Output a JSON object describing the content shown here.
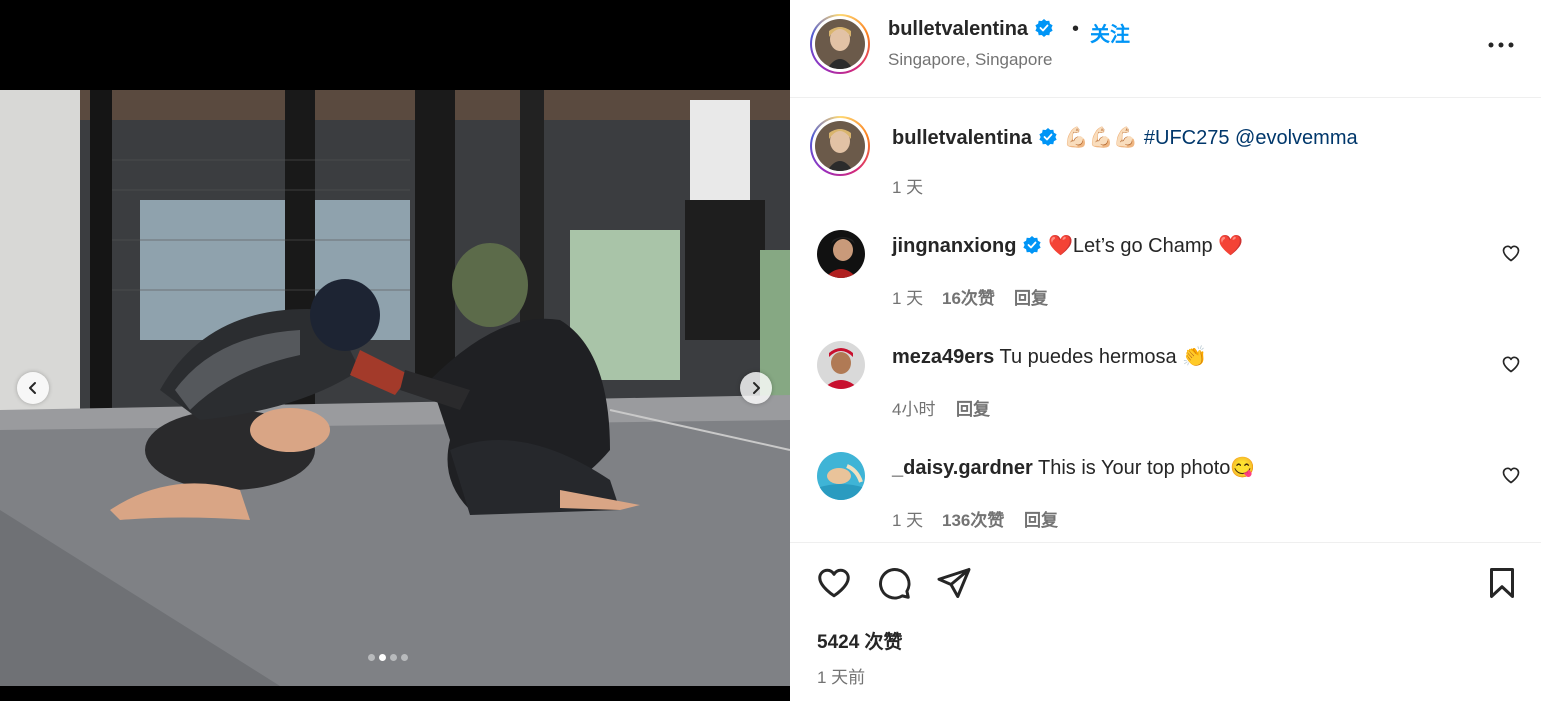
{
  "post": {
    "username": "bulletvalentina",
    "location": "Singapore, Singapore",
    "follow_label": "关注",
    "separator": "•",
    "verified_icon": "verified-badge-icon",
    "verified_color": "#0095f6",
    "accent_color": "#0095f6",
    "more_icon": "more-options-icon"
  },
  "carousel": {
    "image_description_icon": "training-photo",
    "total_slides": 4,
    "active_slide": 2
  },
  "caption": {
    "username": "bulletvalentina",
    "emojis": "💪🏻💪🏻💪🏻",
    "hashtag": "#UFC275",
    "mention": "@evolvemma",
    "time": "1 天"
  },
  "comments": [
    {
      "username": "jingnanxiong",
      "verified": true,
      "text_prefix": "❤️",
      "text": "Let’s go Champ ",
      "text_suffix": "❤️",
      "time": "1 天",
      "likes": "16次赞",
      "reply": "回复"
    },
    {
      "username": "meza49ers",
      "verified": false,
      "text": "Tu puedes hermosa ",
      "text_suffix": "👏",
      "time": "4小时",
      "likes": "",
      "reply": "回复"
    },
    {
      "username": "_daisy.gardner",
      "verified": false,
      "text": "This is Your top photo",
      "text_suffix": "😋",
      "time": "1 天",
      "likes": "136次赞",
      "reply": "回复"
    }
  ],
  "footer": {
    "likes": "5424 次赞",
    "time": "1 天前"
  }
}
